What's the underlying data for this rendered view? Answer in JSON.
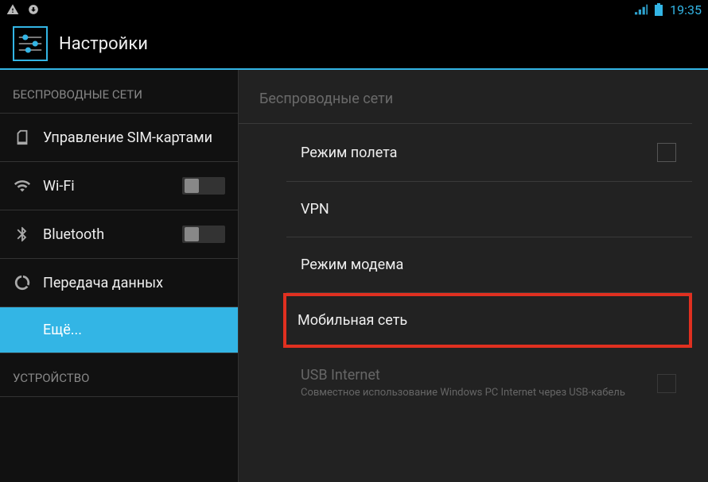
{
  "statusbar": {
    "time": "19:35"
  },
  "header": {
    "title": "Настройки"
  },
  "sidebar": {
    "section1_label": "БЕСПРОВОДНЫЕ СЕТИ",
    "sim": "Управление SIM-картами",
    "wifi": "Wi-Fi",
    "bluetooth": "Bluetooth",
    "data": "Передача данных",
    "more": "Ещё...",
    "section2_label": "УСТРОЙСТВО"
  },
  "main": {
    "section_label": "Беспроводные сети",
    "airplane": "Режим полета",
    "vpn": "VPN",
    "tether": "Режим модема",
    "mobile": "Мобильная сеть",
    "usb_title": "USB Internet",
    "usb_sub": "Совместное использование Windows PC Internet через USB-кабель"
  }
}
